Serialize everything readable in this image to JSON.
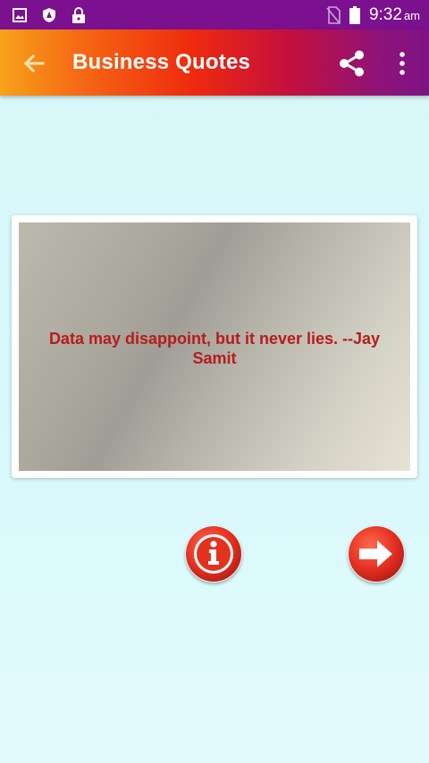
{
  "status_bar": {
    "time": "9:32",
    "ampm": "am",
    "icons": [
      "image-icon",
      "shield-icon",
      "lock-icon",
      "no-sim-icon",
      "battery-icon"
    ]
  },
  "app_bar": {
    "title": "Business Quotes",
    "icons": [
      "back-arrow-icon",
      "share-icon",
      "more-vert-icon"
    ]
  },
  "quote": {
    "text": "Data may disappoint, but it never lies. --Jay Samit"
  },
  "actions": {
    "info_icon": "info-icon",
    "next_icon": "arrow-right-icon"
  },
  "colors": {
    "status_bar": "#7b118f",
    "quote_text": "#b71c1c",
    "button_red": "#e53124"
  }
}
